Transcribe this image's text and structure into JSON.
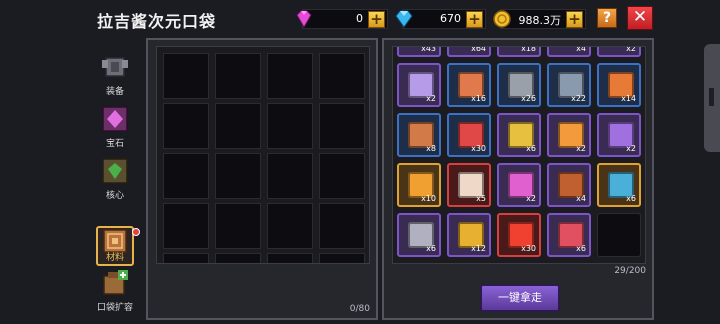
{
  "header": {
    "title": "拉吉酱次元口袋",
    "gems": "0",
    "diamonds": "670",
    "gold": "988.3万",
    "plus_label": "+",
    "help_label": "?",
    "close_label": "✕"
  },
  "sidebar": {
    "items": [
      {
        "label": "装备",
        "icon": "armor-icon"
      },
      {
        "label": "宝石",
        "icon": "gem-icon"
      },
      {
        "label": "核心",
        "icon": "core-icon"
      },
      {
        "label": "材料",
        "icon": "material-icon"
      },
      {
        "label": "口袋扩容",
        "icon": "expand-pocket-icon"
      }
    ]
  },
  "left_panel": {
    "capacity": "0/80"
  },
  "right_panel": {
    "capacity": "29/200",
    "take_all_label": "一键拿走",
    "top_row_counts": [
      "x43",
      "x64",
      "x18",
      "x4",
      "x2"
    ],
    "items": [
      {
        "name": "feather-icon",
        "qty": "x2",
        "rarity": "purple",
        "color": "#b69be8"
      },
      {
        "name": "pipe-icon",
        "qty": "x16",
        "rarity": "blue",
        "color": "#e07a4c"
      },
      {
        "name": "spring-icon",
        "qty": "x26",
        "rarity": "blue",
        "color": "#9aa0aa"
      },
      {
        "name": "barrel-icon",
        "qty": "x22",
        "rarity": "blue",
        "color": "#8a9aae"
      },
      {
        "name": "battery-icon",
        "qty": "x14",
        "rarity": "blue",
        "color": "#e87a38"
      },
      {
        "name": "gun-part-icon",
        "qty": "x8",
        "rarity": "blue",
        "color": "#d27a48"
      },
      {
        "name": "sword-icon",
        "qty": "x30",
        "rarity": "blue",
        "color": "#e04848"
      },
      {
        "name": "chip-icon",
        "qty": "x6",
        "rarity": "purple",
        "color": "#e8c040"
      },
      {
        "name": "gear-icon",
        "qty": "x2",
        "rarity": "purple",
        "color": "#f29a3c"
      },
      {
        "name": "helmet-icon",
        "qty": "x2",
        "rarity": "purple",
        "color": "#a070e0"
      },
      {
        "name": "medallion-icon",
        "qty": "x10",
        "rarity": "gold",
        "color": "#f0a030"
      },
      {
        "name": "crystal-cake-icon",
        "qty": "x5",
        "rarity": "red",
        "color": "#f0d8c8"
      },
      {
        "name": "heart-gem-icon",
        "qty": "x2",
        "rarity": "purple",
        "color": "#e060d0"
      },
      {
        "name": "gauntlet-icon",
        "qty": "x4",
        "rarity": "purple",
        "color": "#c06030"
      },
      {
        "name": "emblem-icon",
        "qty": "x6",
        "rarity": "gold",
        "color": "#4ab0d8"
      },
      {
        "name": "coil-icon",
        "qty": "x6",
        "rarity": "purple",
        "color": "#b0b0c0"
      },
      {
        "name": "trophy-icon",
        "qty": "x12",
        "rarity": "purple",
        "color": "#e8b030"
      },
      {
        "name": "fire-orb-icon",
        "qty": "x30",
        "rarity": "red",
        "color": "#f04030"
      },
      {
        "name": "ring-icon",
        "qty": "x6",
        "rarity": "purple",
        "color": "#e05060"
      }
    ]
  },
  "colors": {
    "background": "#1b1b22",
    "accent_gold": "#e9b34c",
    "button_purple": "#7a52c4",
    "close_red": "#d83236"
  }
}
